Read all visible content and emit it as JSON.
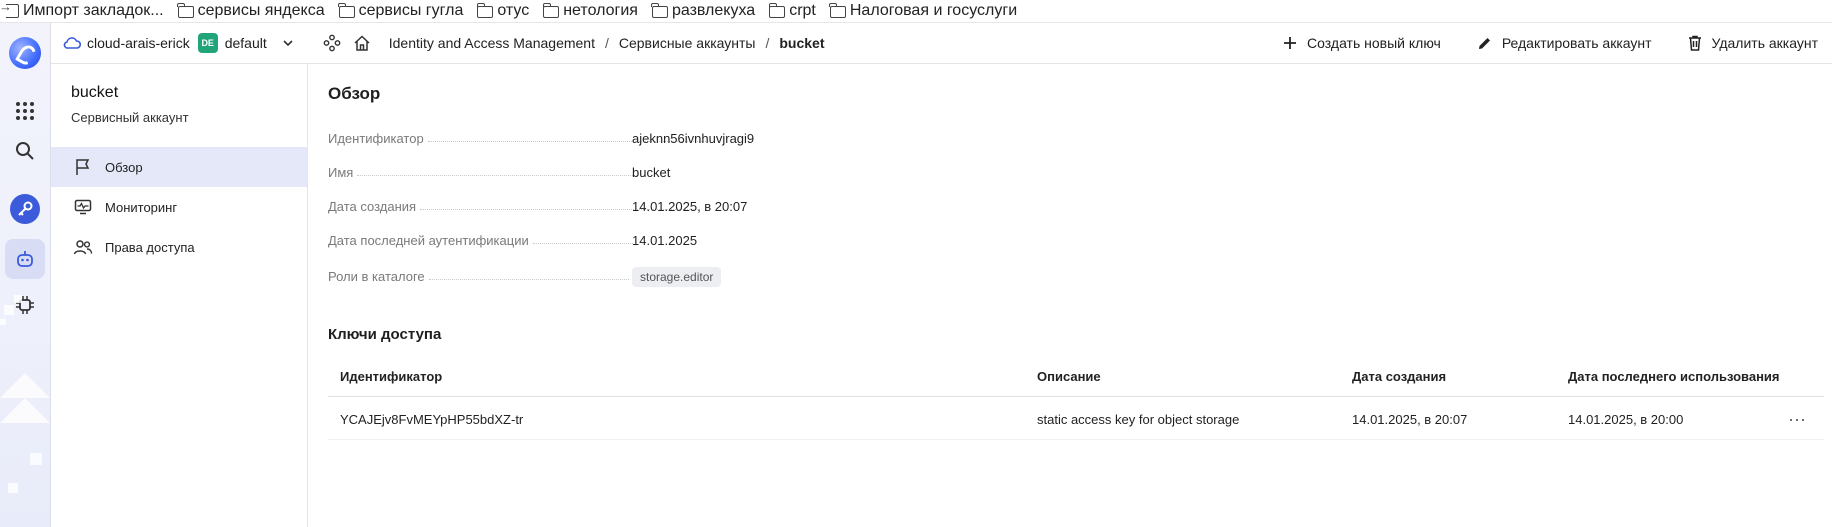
{
  "bookmarks": [
    {
      "label": "Импорт закладок...",
      "icon": "import-icon"
    },
    {
      "label": "сервисы яндекса",
      "icon": "folder-icon"
    },
    {
      "label": "сервисы гугла",
      "icon": "folder-icon"
    },
    {
      "label": "отус",
      "icon": "folder-icon"
    },
    {
      "label": "нетология",
      "icon": "folder-icon"
    },
    {
      "label": "развлекуха",
      "icon": "folder-icon"
    },
    {
      "label": "crpt",
      "icon": "folder-icon"
    },
    {
      "label": "Налоговая  и госуслуги",
      "icon": "folder-icon"
    }
  ],
  "header": {
    "cloud": "cloud-arais-erick",
    "folder_badge": "DE",
    "folder": "default",
    "breadcrumbs": [
      "Identity and Access Management",
      "Сервисные аккаунты",
      "bucket"
    ],
    "separator": "/",
    "actions": {
      "create_key": "Создать новый ключ",
      "edit": "Редактировать аккаунт",
      "delete": "Удалить аккаунт"
    }
  },
  "sidebar": {
    "title": "bucket",
    "subtitle": "Сервисный аккаунт",
    "items": [
      {
        "label": "Обзор",
        "icon": "flag-icon",
        "active": true
      },
      {
        "label": "Мониторинг",
        "icon": "monitor-icon",
        "active": false
      },
      {
        "label": "Права доступа",
        "icon": "users-icon",
        "active": false
      }
    ]
  },
  "overview": {
    "title": "Обзор",
    "props": [
      {
        "label": "Идентификатор",
        "value": "ajeknn56ivnhuvjragi9"
      },
      {
        "label": "Имя",
        "value": "bucket"
      },
      {
        "label": "Дата создания",
        "value": "14.01.2025, в 20:07"
      },
      {
        "label": "Дата последней аутентификации",
        "value": "14.01.2025"
      },
      {
        "label": "Роли в каталоге",
        "value": "storage.editor"
      }
    ]
  },
  "keys": {
    "title": "Ключи доступа",
    "columns": [
      "Идентификатор",
      "Описание",
      "Дата создания",
      "Дата последнего использования"
    ],
    "rows": [
      {
        "id": "YCAJEjv8FvMEYpHP55bdXZ-tr",
        "description": "static access key for object storage",
        "created": "14.01.2025, в 20:07",
        "last_used": "14.01.2025, в 20:00",
        "menu": "···"
      }
    ]
  },
  "colors": {
    "accent": "#3b5bdb",
    "active_nav": "#e4e8f9",
    "badge_green": "#22a47a"
  }
}
